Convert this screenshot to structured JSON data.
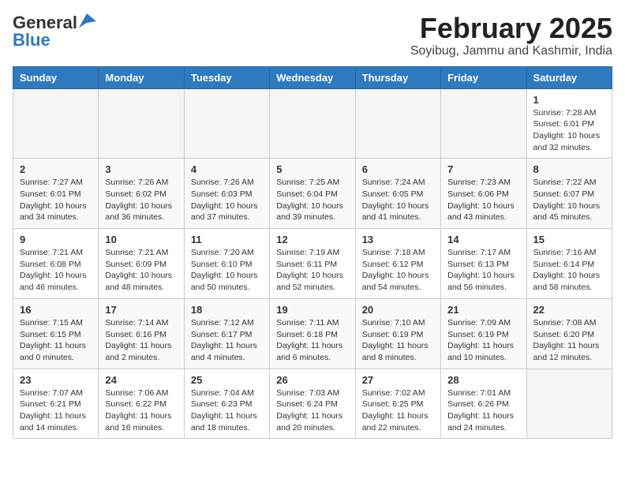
{
  "header": {
    "logo": {
      "general": "General",
      "blue": "Blue",
      "bird_symbol": "▲"
    },
    "title": "February 2025",
    "subtitle": "Soyibug, Jammu and Kashmir, India"
  },
  "calendar": {
    "days_of_week": [
      "Sunday",
      "Monday",
      "Tuesday",
      "Wednesday",
      "Thursday",
      "Friday",
      "Saturday"
    ],
    "weeks": [
      [
        {
          "day": "",
          "info": ""
        },
        {
          "day": "",
          "info": ""
        },
        {
          "day": "",
          "info": ""
        },
        {
          "day": "",
          "info": ""
        },
        {
          "day": "",
          "info": ""
        },
        {
          "day": "",
          "info": ""
        },
        {
          "day": "1",
          "info": "Sunrise: 7:28 AM\nSunset: 6:01 PM\nDaylight: 10 hours and 32 minutes."
        }
      ],
      [
        {
          "day": "2",
          "info": "Sunrise: 7:27 AM\nSunset: 6:01 PM\nDaylight: 10 hours and 34 minutes."
        },
        {
          "day": "3",
          "info": "Sunrise: 7:26 AM\nSunset: 6:02 PM\nDaylight: 10 hours and 36 minutes."
        },
        {
          "day": "4",
          "info": "Sunrise: 7:26 AM\nSunset: 6:03 PM\nDaylight: 10 hours and 37 minutes."
        },
        {
          "day": "5",
          "info": "Sunrise: 7:25 AM\nSunset: 6:04 PM\nDaylight: 10 hours and 39 minutes."
        },
        {
          "day": "6",
          "info": "Sunrise: 7:24 AM\nSunset: 6:05 PM\nDaylight: 10 hours and 41 minutes."
        },
        {
          "day": "7",
          "info": "Sunrise: 7:23 AM\nSunset: 6:06 PM\nDaylight: 10 hours and 43 minutes."
        },
        {
          "day": "8",
          "info": "Sunrise: 7:22 AM\nSunset: 6:07 PM\nDaylight: 10 hours and 45 minutes."
        }
      ],
      [
        {
          "day": "9",
          "info": "Sunrise: 7:21 AM\nSunset: 6:08 PM\nDaylight: 10 hours and 46 minutes."
        },
        {
          "day": "10",
          "info": "Sunrise: 7:21 AM\nSunset: 6:09 PM\nDaylight: 10 hours and 48 minutes."
        },
        {
          "day": "11",
          "info": "Sunrise: 7:20 AM\nSunset: 6:10 PM\nDaylight: 10 hours and 50 minutes."
        },
        {
          "day": "12",
          "info": "Sunrise: 7:19 AM\nSunset: 6:11 PM\nDaylight: 10 hours and 52 minutes."
        },
        {
          "day": "13",
          "info": "Sunrise: 7:18 AM\nSunset: 6:12 PM\nDaylight: 10 hours and 54 minutes."
        },
        {
          "day": "14",
          "info": "Sunrise: 7:17 AM\nSunset: 6:13 PM\nDaylight: 10 hours and 56 minutes."
        },
        {
          "day": "15",
          "info": "Sunrise: 7:16 AM\nSunset: 6:14 PM\nDaylight: 10 hours and 58 minutes."
        }
      ],
      [
        {
          "day": "16",
          "info": "Sunrise: 7:15 AM\nSunset: 6:15 PM\nDaylight: 11 hours and 0 minutes."
        },
        {
          "day": "17",
          "info": "Sunrise: 7:14 AM\nSunset: 6:16 PM\nDaylight: 11 hours and 2 minutes."
        },
        {
          "day": "18",
          "info": "Sunrise: 7:12 AM\nSunset: 6:17 PM\nDaylight: 11 hours and 4 minutes."
        },
        {
          "day": "19",
          "info": "Sunrise: 7:11 AM\nSunset: 6:18 PM\nDaylight: 11 hours and 6 minutes."
        },
        {
          "day": "20",
          "info": "Sunrise: 7:10 AM\nSunset: 6:19 PM\nDaylight: 11 hours and 8 minutes."
        },
        {
          "day": "21",
          "info": "Sunrise: 7:09 AM\nSunset: 6:19 PM\nDaylight: 11 hours and 10 minutes."
        },
        {
          "day": "22",
          "info": "Sunrise: 7:08 AM\nSunset: 6:20 PM\nDaylight: 11 hours and 12 minutes."
        }
      ],
      [
        {
          "day": "23",
          "info": "Sunrise: 7:07 AM\nSunset: 6:21 PM\nDaylight: 11 hours and 14 minutes."
        },
        {
          "day": "24",
          "info": "Sunrise: 7:06 AM\nSunset: 6:22 PM\nDaylight: 11 hours and 16 minutes."
        },
        {
          "day": "25",
          "info": "Sunrise: 7:04 AM\nSunset: 6:23 PM\nDaylight: 11 hours and 18 minutes."
        },
        {
          "day": "26",
          "info": "Sunrise: 7:03 AM\nSunset: 6:24 PM\nDaylight: 11 hours and 20 minutes."
        },
        {
          "day": "27",
          "info": "Sunrise: 7:02 AM\nSunset: 6:25 PM\nDaylight: 11 hours and 22 minutes."
        },
        {
          "day": "28",
          "info": "Sunrise: 7:01 AM\nSunset: 6:26 PM\nDaylight: 11 hours and 24 minutes."
        },
        {
          "day": "",
          "info": ""
        }
      ]
    ]
  }
}
